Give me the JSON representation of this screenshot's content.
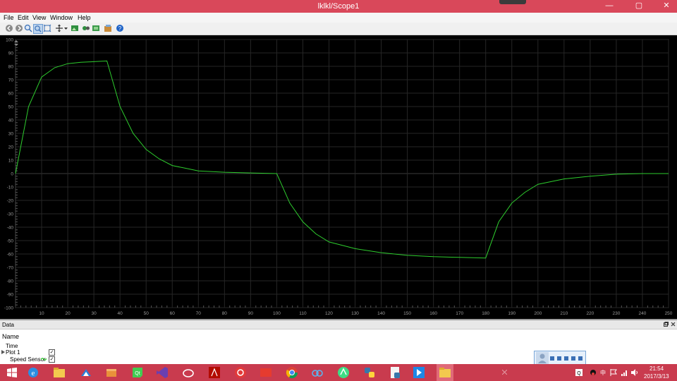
{
  "window": {
    "title": "lklkl/Scope1"
  },
  "window_controls": {
    "minimize": "—",
    "maximize": "▢",
    "close": "✕"
  },
  "menu": [
    "File",
    "Edit",
    "View",
    "Window",
    "Help"
  ],
  "toolbar_icons": [
    "back-icon",
    "forward-icon",
    "zoom-in-icon",
    "zoom-box-icon",
    "zoom-fit-icon",
    "pan-icon",
    "dropdown-icon",
    "image-icon",
    "camera-icon",
    "export-icon",
    "settings-icon",
    "help-icon"
  ],
  "chart_data": {
    "type": "line",
    "title": "",
    "xlabel": "",
    "ylabel": "",
    "xlim": [
      0,
      250
    ],
    "ylim": [
      -100,
      100
    ],
    "x_ticks": [
      10,
      20,
      30,
      40,
      50,
      60,
      70,
      80,
      90,
      100,
      110,
      120,
      130,
      140,
      150,
      160,
      170,
      180,
      190,
      200,
      210,
      220,
      230,
      240,
      250
    ],
    "y_ticks": [
      100,
      90,
      80,
      70,
      60,
      50,
      40,
      30,
      20,
      10,
      0,
      -10,
      -20,
      -30,
      -40,
      -50,
      -60,
      -70,
      -80,
      -90,
      -100
    ],
    "grid": true,
    "series": [
      {
        "name": "Speed Sensor",
        "color": "#2ecc2e",
        "points": [
          [
            0,
            0
          ],
          [
            5,
            50
          ],
          [
            10,
            72
          ],
          [
            15,
            79
          ],
          [
            20,
            82
          ],
          [
            25,
            83
          ],
          [
            30,
            83.5
          ],
          [
            35,
            84
          ],
          [
            40,
            50
          ],
          [
            45,
            30
          ],
          [
            50,
            18
          ],
          [
            55,
            11
          ],
          [
            60,
            6
          ],
          [
            65,
            4
          ],
          [
            70,
            2
          ],
          [
            80,
            1
          ],
          [
            90,
            0.5
          ],
          [
            100,
            0
          ],
          [
            105,
            -22
          ],
          [
            110,
            -36
          ],
          [
            115,
            -45
          ],
          [
            120,
            -51
          ],
          [
            130,
            -56
          ],
          [
            140,
            -59
          ],
          [
            150,
            -61
          ],
          [
            160,
            -62
          ],
          [
            170,
            -62.5
          ],
          [
            180,
            -63
          ],
          [
            185,
            -36
          ],
          [
            190,
            -22
          ],
          [
            195,
            -14
          ],
          [
            200,
            -8
          ],
          [
            210,
            -4
          ],
          [
            220,
            -2
          ],
          [
            230,
            -0.5
          ],
          [
            240,
            0
          ],
          [
            250,
            0
          ]
        ]
      }
    ]
  },
  "data_panel": {
    "header": "Data",
    "name_label": "Name",
    "time_label": "Time",
    "plot_label": "Plot 1",
    "signal_label": "Speed Sensor",
    "check_mark": "✓"
  },
  "taskbar": {
    "time": "21:54",
    "date": "2017/3/13",
    "input_method": "中",
    "app_icons": [
      "windows-start-icon",
      "ie-icon",
      "file-explorer-icon",
      "xmind-icon",
      "box-icon",
      "qt-icon",
      "visual-studio-icon",
      "cloud-icon",
      "acrobat-icon",
      "music-icon",
      "app-red-icon",
      "chrome-icon",
      "baidu-cloud-icon",
      "android-studio-icon",
      "python-icon",
      "python-doc-icon",
      "media-icon",
      "folder-icon"
    ]
  },
  "colors": {
    "accent": "#d9485a",
    "taskbar": "#c93b4e",
    "plot_bg": "#000000",
    "signal": "#2ecc2e"
  }
}
